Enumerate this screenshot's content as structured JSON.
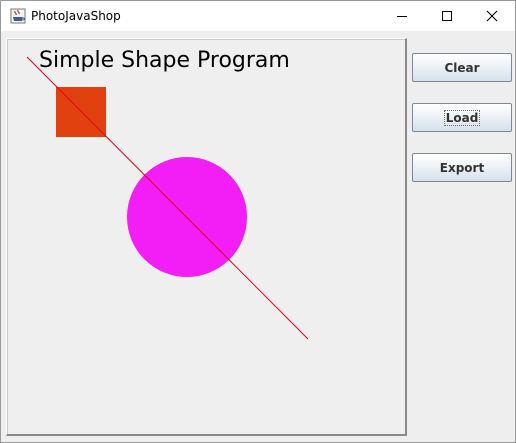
{
  "window": {
    "title": "PhotoJavaShop"
  },
  "canvas": {
    "title": "Simple Shape Program",
    "shapes": {
      "square_color": "#e0410f",
      "circle_color": "#f21ef5",
      "line_color": "#e8001a"
    }
  },
  "buttons": {
    "clear": "Clear",
    "load": "Load",
    "export": "Export"
  },
  "colors": {
    "button_border": "#7a8a99",
    "background": "#eeeeee"
  },
  "icons": {
    "app": "java-cup-icon",
    "minimize": "minimize-icon",
    "maximize": "maximize-icon",
    "close": "close-icon"
  }
}
